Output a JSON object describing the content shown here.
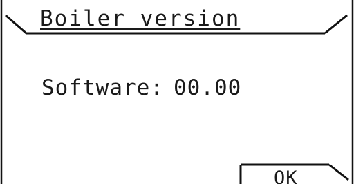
{
  "header": {
    "title": "Boiler version"
  },
  "main": {
    "label": "Software:",
    "value": "00.00"
  },
  "footer": {
    "ok_label": "OK"
  }
}
